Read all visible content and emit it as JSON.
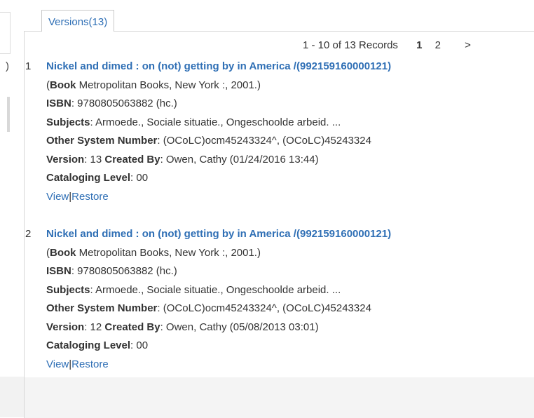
{
  "left": {
    "paren": ")"
  },
  "tab": {
    "label": "Versions(13)"
  },
  "pager": {
    "range": "1 - 10 of 13 Records",
    "current": "1",
    "page2": "2",
    "next": ">"
  },
  "records": [
    {
      "num": "1",
      "title": "Nickel and dimed : on (not) getting by in America /(992159160000121)",
      "pub_open": "(",
      "pub_type": "Book",
      "pub_rest": " Metropolitan Books, New York :, 2001.)",
      "isbn_label": "ISBN",
      "isbn": ": 9780805063882 (hc.)",
      "subjects_label": "Subjects",
      "subjects": ": Armoede., Sociale situatie., Ongeschoolde arbeid. ...",
      "osn_label": "Other System Number",
      "osn": ": (OCoLC)ocm45243324^, (OCoLC)45243324",
      "version_label": "Version",
      "version": ": 13 ",
      "created_label": "Created By",
      "created": ": Owen, Cathy (01/24/2016 13:44)",
      "cat_label": "Cataloging Level",
      "cat": ": 00",
      "view": "View",
      "sep": "|",
      "restore": "Restore"
    },
    {
      "num": "2",
      "title": "Nickel and dimed : on (not) getting by in America /(992159160000121)",
      "pub_open": "(",
      "pub_type": "Book",
      "pub_rest": " Metropolitan Books, New York :, 2001.)",
      "isbn_label": "ISBN",
      "isbn": ": 9780805063882 (hc.)",
      "subjects_label": "Subjects",
      "subjects": ": Armoede., Sociale situatie., Ongeschoolde arbeid. ...",
      "osn_label": "Other System Number",
      "osn": ": (OCoLC)ocm45243324^, (OCoLC)45243324",
      "version_label": "Version",
      "version": ": 12 ",
      "created_label": "Created By",
      "created": ": Owen, Cathy (05/08/2013 03:01)",
      "cat_label": "Cataloging Level",
      "cat": ": 00",
      "view": "View",
      "sep": "|",
      "restore": "Restore"
    }
  ]
}
